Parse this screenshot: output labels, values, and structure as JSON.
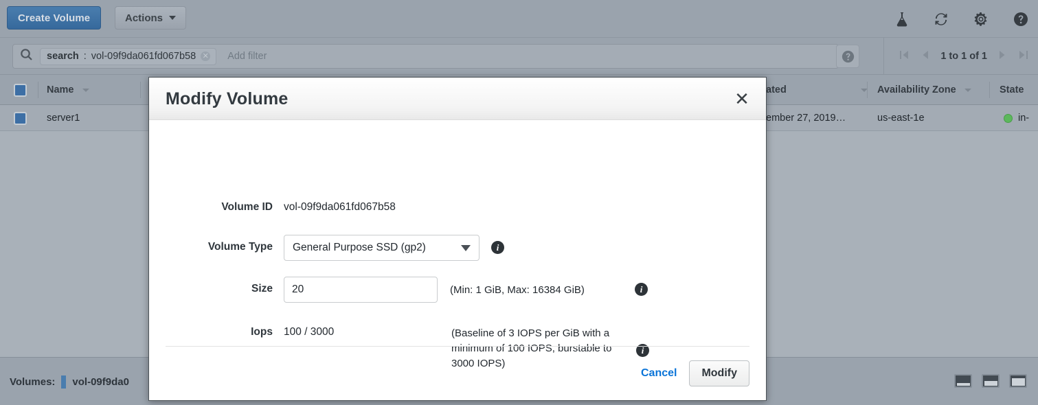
{
  "toolbar": {
    "create_volume_label": "Create Volume",
    "actions_label": "Actions",
    "icons": [
      "flask-icon",
      "refresh-icon",
      "gear-icon",
      "help-icon"
    ]
  },
  "search": {
    "token_key": "search",
    "token_sep": " : ",
    "token_value": "vol-09f9da061fd067b58",
    "add_filter_placeholder": "Add filter"
  },
  "pagination": {
    "range_label": "1 to 1 of 1"
  },
  "table": {
    "columns": [
      "Name",
      "ated",
      "Availability Zone",
      "State"
    ],
    "rows": [
      {
        "name": "server1",
        "created": "ember 27, 2019…",
        "availability_zone": "us-east-1e",
        "state": "in-"
      }
    ]
  },
  "bottom_bar": {
    "volumes_label": "Volumes:",
    "volume_id": "vol-09f9da0"
  },
  "modal": {
    "title": "Modify Volume",
    "close_glyph": "✕",
    "fields": {
      "volume_id_label": "Volume ID",
      "volume_id_value": "vol-09f9da061fd067b58",
      "volume_type_label": "Volume Type",
      "volume_type_value": "General Purpose SSD (gp2)",
      "size_label": "Size",
      "size_value": "20",
      "size_hint": "(Min: 1 GiB, Max: 16384 GiB)",
      "iops_label": "Iops",
      "iops_value": "100 / 3000",
      "iops_hint": "(Baseline of 3 IOPS per GiB with a minimum of 100 IOPS, burstable to 3000 IOPS)"
    },
    "footer": {
      "cancel_label": "Cancel",
      "modify_label": "Modify"
    }
  },
  "colors": {
    "primary_button": "#36699c",
    "link": "#0a74d8",
    "status_ok": "#5cb85c",
    "modal_bg": "#ffffff",
    "console_dim": "#9aa3ad"
  }
}
